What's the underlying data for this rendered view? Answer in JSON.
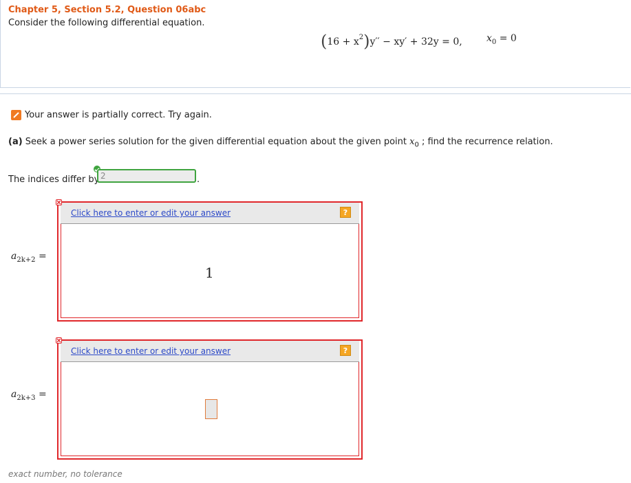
{
  "question": {
    "title": "Chapter 5, Section 5.2, Question 06abc",
    "prompt": "Consider the following differential equation.",
    "equation": {
      "lhs_paren_content": "16 + x",
      "exponent": "2",
      "rest": "y′′ − xy′ + 32y = 0,",
      "point": "x",
      "point_sub": "0",
      "point_value": " = 0"
    }
  },
  "feedback": {
    "icon": "pencil-icon",
    "message": "Your answer is partially correct.  Try again."
  },
  "part_a": {
    "label": "(a)",
    "text": "Seek a power series solution for the given differential equation about the given point",
    "point": "x",
    "point_sub": "0",
    "text_after": "; find the recurrence relation."
  },
  "indices": {
    "label": "The indices differ by",
    "value": "2",
    "status": "correct",
    "period": "."
  },
  "answers": [
    {
      "lhs_var": "a",
      "lhs_sub": "2k+2",
      "equals": "=",
      "edit_link": "Click here to enter or edit your answer",
      "help": "?",
      "content": "1",
      "status": "incorrect"
    },
    {
      "lhs_var": "a",
      "lhs_sub": "2k+3",
      "equals": "=",
      "edit_link": "Click here to enter or edit your answer",
      "help": "?",
      "content": "",
      "status": "incorrect"
    }
  ],
  "footer": "exact number, no tolerance",
  "colors": {
    "title": "#e05a17",
    "error_border": "#e0262a",
    "correct_border": "#3fa43f",
    "link": "#2c49c8",
    "help_icon": "#f5a623"
  }
}
